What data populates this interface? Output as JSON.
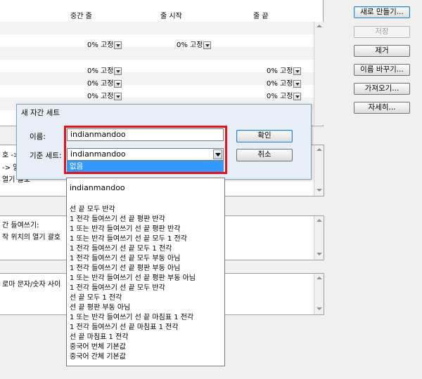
{
  "columns": [
    "중간 줄",
    "줄 시작",
    "줄 끝"
  ],
  "rows": [
    {
      "mid": "0% 고정",
      "start": "0% 고정",
      "end": ""
    },
    {
      "mid": "0% 고정",
      "start": "",
      "end": "0% 고정"
    },
    {
      "mid": "0% 고정",
      "start": "",
      "end": "0% 고정"
    },
    {
      "mid": "0% 고정",
      "start": "",
      "end": "0% 고정"
    }
  ],
  "buttons": {
    "new": "새로 만들기...",
    "save": "저장",
    "delete": "제거",
    "rename": "이름 바꾸기...",
    "import": "가져오기...",
    "details": "자세히..."
  },
  "panels": {
    "p1_line1": "호 ->",
    "p1_line2": "-> 열",
    "p1_line3": "열기 괄호",
    "p2_line1": "간 들여쓰기:",
    "p2_line2": "작 위치의 열기 괄호",
    "p3_line1": "로마 문자/숫자 사이"
  },
  "dialog": {
    "title": "새 자간 세트",
    "name_label": "이름:",
    "name_value": "indianmandoo",
    "base_label": "기준 세트:",
    "base_value": "indianmandoo",
    "highlighted_option": "없음",
    "ok": "확인",
    "cancel": "취소"
  },
  "dropdown_options": [
    "indianmandoo",
    "선 끝 모두 반각",
    "1 전각 들여쓰기 선 끝 평판 반각",
    "1 또는 반각 들여쓰기 선 끝 평판 반각",
    "1 또는 반각 들여쓰기 선 끝 모두 1 전각",
    "1 전각 들여쓰기 선 끝 모두 1 전각",
    "1 전각 들여쓰기 선 끝 모두 부동 아님",
    "1 전각 들여쓰기 선 끝 평판 부동 아님",
    "1 또는 반각 들여쓰기 선 끝 평판 부동 아님",
    "1 전각 들여쓰기 선 끝 모두 반각",
    "선 끝 모두 1 전각",
    "선 끝 평판 부동 아님",
    "1 또는 반각 들여쓰기 선 끝 마침표 1 전각",
    "1 전각 들여쓰기 선 끝 마침표 1 전각",
    "선 끝 마침표 1 전각",
    "중국어 번체 기본값",
    "중국어 간체 기본값"
  ]
}
